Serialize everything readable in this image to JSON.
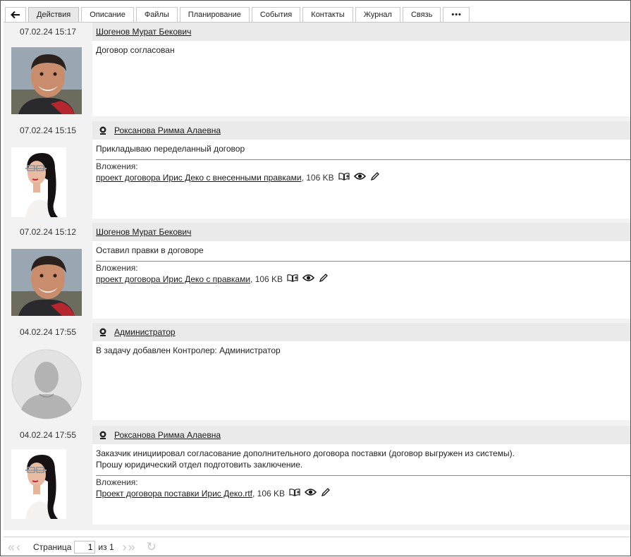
{
  "tabs": {
    "back_icon": "arrow-left",
    "items": [
      "Действия",
      "Описание",
      "Файлы",
      "Планирование",
      "События",
      "Контакты",
      "Журнал",
      "Связь"
    ],
    "more": "•••"
  },
  "entries": [
    {
      "date": "07.02.24 15:17",
      "author": "Шогенов Мурат Бекович",
      "online_icon": false,
      "message": [
        "Договор согласован"
      ],
      "attachments_label": "",
      "attachment": null
    },
    {
      "date": "07.02.24 15:15",
      "author": "Роксанова Римма Алаевна",
      "online_icon": true,
      "message": [
        "Прикладываю переделанный договор"
      ],
      "attachments_label": "Вложения:",
      "attachment": {
        "name": "проект договора Ирис Деко с внесенными правками",
        "size": ", 106 KB"
      }
    },
    {
      "date": "07.02.24 15:12",
      "author": "Шогенов Мурат Бекович",
      "online_icon": false,
      "message": [
        "Оставил правки в договоре"
      ],
      "attachments_label": "Вложения:",
      "attachment": {
        "name": "проект договора Ирис Деко с правками",
        "size": ", 106 KB"
      }
    },
    {
      "date": "04.02.24 17:55",
      "author": "Администратор",
      "online_icon": true,
      "message": [
        "В задачу добавлен Контролер: Администратор"
      ],
      "attachments_label": "",
      "attachment": null
    },
    {
      "date": "04.02.24 17:55",
      "author": "Роксанова Римма Алаевна",
      "online_icon": true,
      "message": [
        "Заказчик инициировал согласование дополнительного договора поставки (договор выгружен из системы).",
        "Прошу юридический отдел подготовить заключение."
      ],
      "attachments_label": "Вложения:",
      "attachment": {
        "name": "Проект договора поставки Ирис Деко.rtf",
        "size": ", 106 KB"
      }
    }
  ],
  "pager": {
    "label": "Страница",
    "current": "1",
    "of": "из 1"
  },
  "colors": {
    "header_bg": "#eaeaea",
    "panel_bg": "#f2f2f2",
    "active_tab": "#e8e8e8"
  }
}
